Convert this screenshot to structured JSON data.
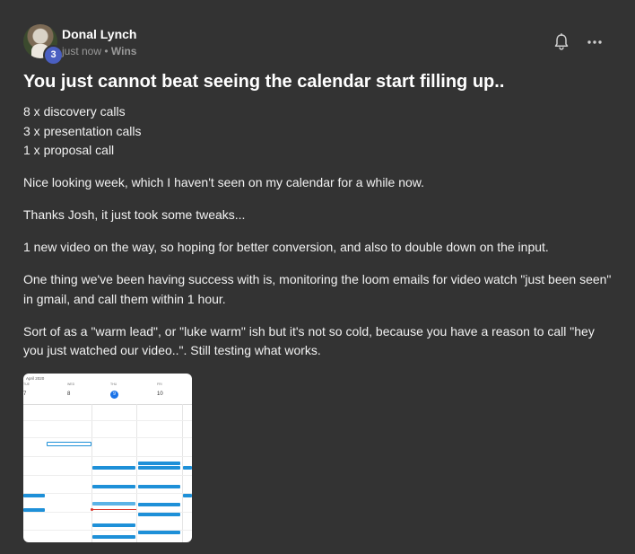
{
  "post": {
    "author": {
      "name": "Donal Lynch",
      "level": "3"
    },
    "meta": {
      "time": "just now",
      "separator": " • ",
      "category": "Wins"
    },
    "icons": {
      "bell": "bell-icon",
      "more": "more-options-icon"
    },
    "title": "You just cannot beat seeing the calendar start filling up..",
    "list_lines": [
      "8 x discovery calls",
      "3 x presentation calls",
      "1 x proposal call"
    ],
    "paragraphs": [
      "Nice looking week, which I haven't seen on my calendar for a while now.",
      "Thanks Josh, it just took some tweaks...",
      "1 new video on the way, so hoping for better conversion, and also to double down on the input.",
      "One thing we've been having success with is, monitoring the loom emails for video watch \"just been seen\" in gmail, and call them within 1 hour.",
      "Sort of as a \"warm lead\", or \"luke warm\" ish but it's not so cold, because you have a reason to call \"hey you just watched our video..\". Still testing what works."
    ],
    "attachment": {
      "month": "April 2020",
      "days": [
        {
          "dow": "TUE",
          "num": "7"
        },
        {
          "dow": "WED",
          "num": "8"
        },
        {
          "dow": "THU",
          "num": "9"
        },
        {
          "dow": "FRI",
          "num": "10"
        }
      ]
    }
  },
  "colors": {
    "background": "#333333",
    "accent": "#4a5fc1",
    "event": "#1e90d8"
  }
}
